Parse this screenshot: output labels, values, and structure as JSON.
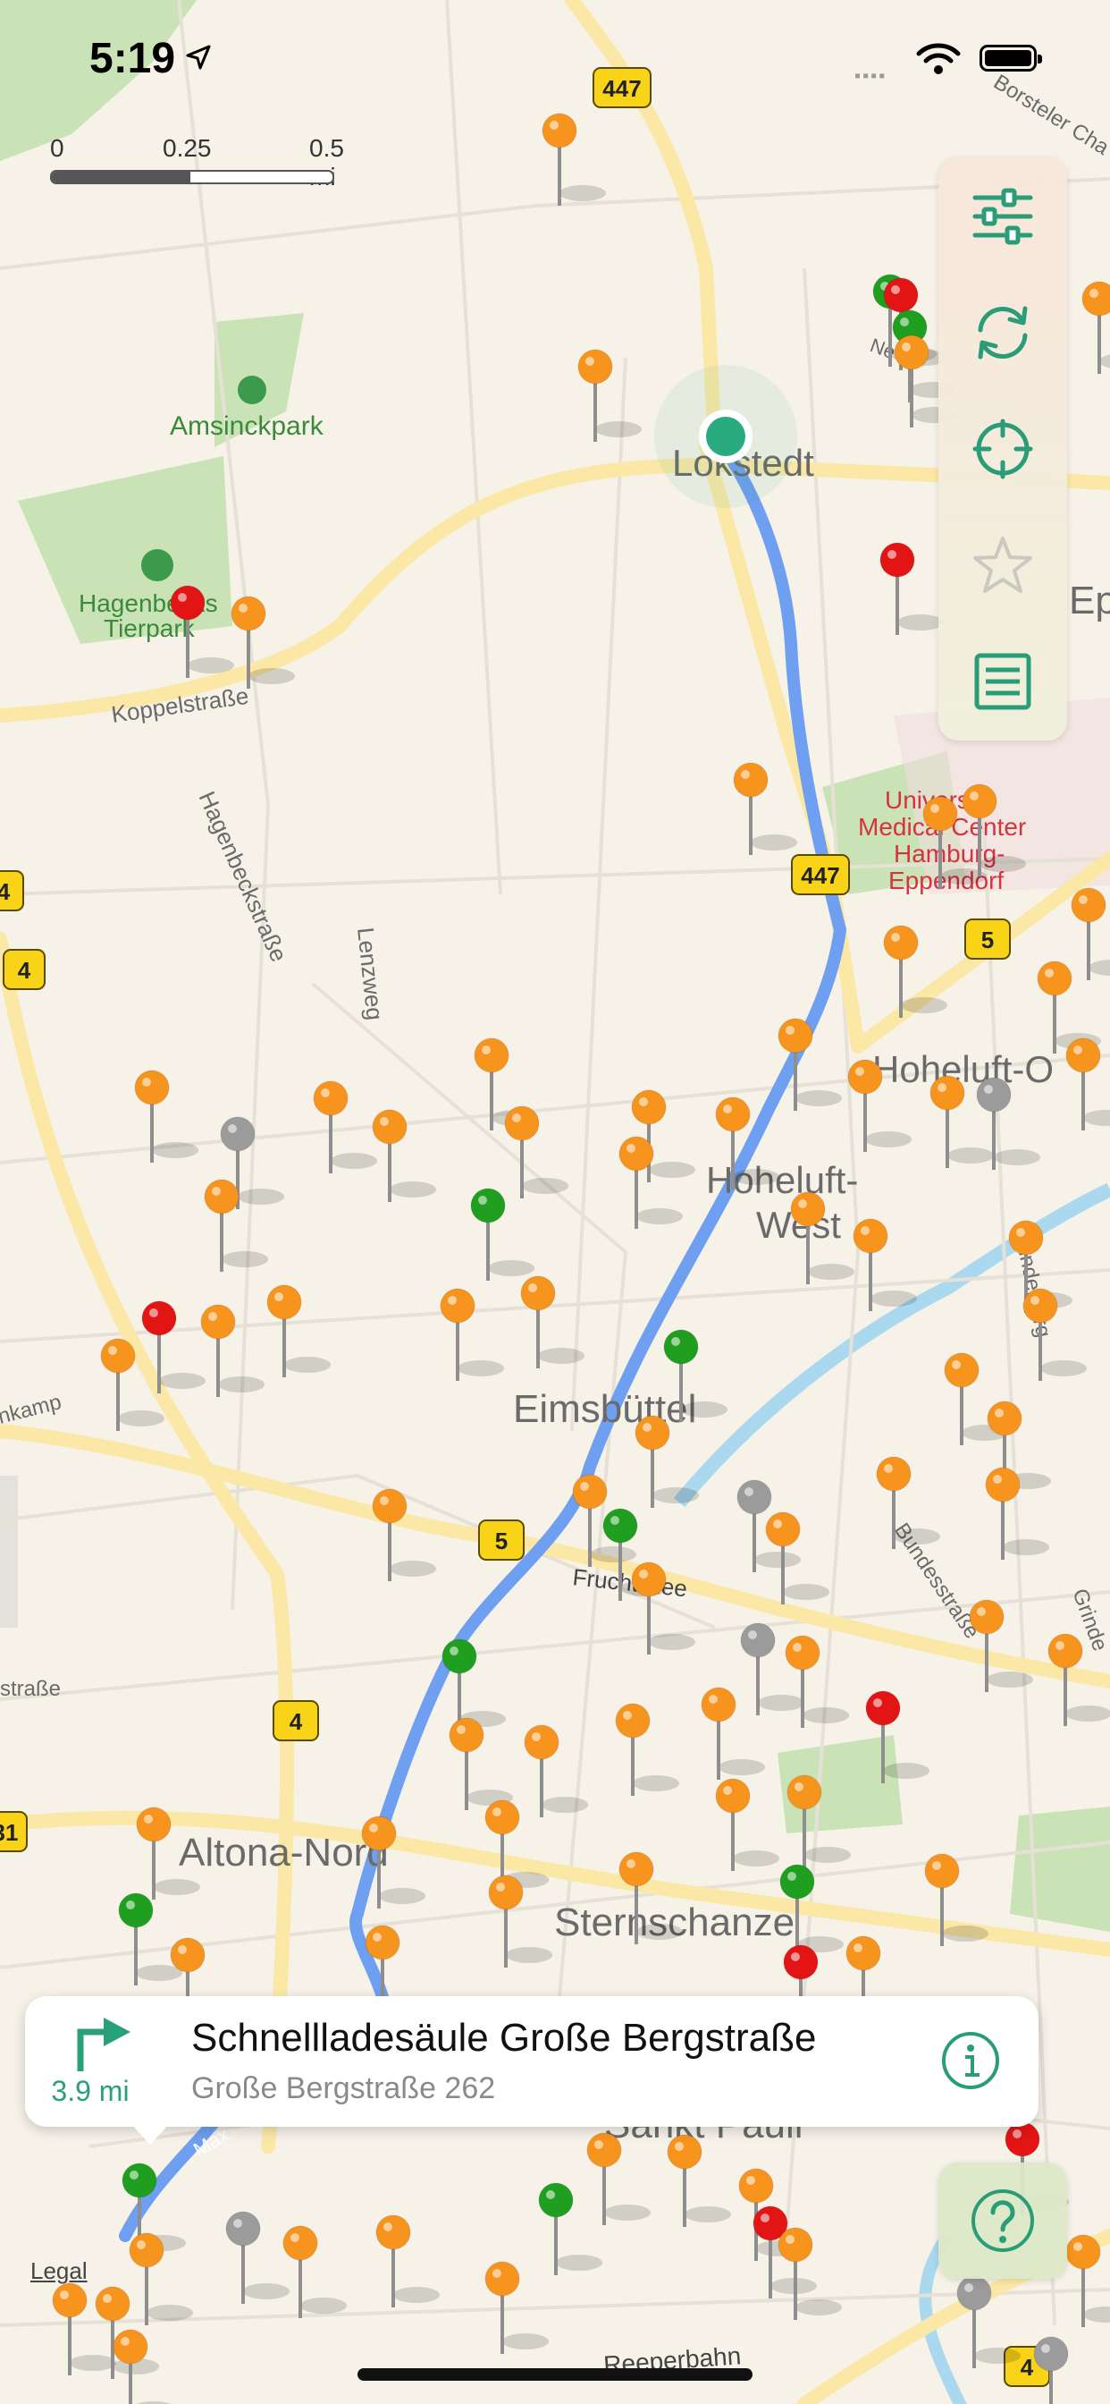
{
  "status_bar": {
    "time": "5:19",
    "icons": [
      "location-arrow-icon",
      "cellular-signal-icon",
      "wifi-icon",
      "battery-icon"
    ]
  },
  "scale": {
    "labels": [
      "0",
      "0.25",
      "0.5 mi"
    ]
  },
  "map": {
    "labels": {
      "lokstedt": "Lokstedt",
      "amsinckpark": "Amsinckpark",
      "hagenbecks": "Hagenbecks",
      "tierpark": "Tierpark",
      "koppelstrasse": "Koppelstraße",
      "hagenbeckstrasse": "Hagenbeckstraße",
      "lenzweg": "Lenzweg",
      "university_1": "University",
      "university_2": "Medical Center",
      "university_3": "Hamburg-",
      "university_4": "Eppendorf",
      "hoheluft_ost": "Hoheluft-O",
      "hoheluft_west_1": "Hoheluft-",
      "hoheluft_west_2": "West",
      "eimsbuettel": "Eimsbüttel",
      "fruchtallee": "Fruchtallee",
      "altona_nord": "Altona-Nord",
      "sternschanze": "Sternschanze",
      "sankt_pauli": "Sankt Pauli",
      "reeperbahn": "Reeperbahn",
      "bundesstrasse": "Bundesstraße",
      "isebek": "indelberg",
      "grindel": "Grinde",
      "borsteler": "Borsteler Cha",
      "ep": "Ep",
      "nkamp": "nkamp",
      "strasse_left": "straße",
      "maxstr": "Max",
      "ne": "Ne"
    },
    "road_shields": [
      "447",
      "447",
      "5",
      "5",
      "4",
      "4",
      "4",
      "31",
      "4"
    ],
    "colors": {
      "route": "#6f9ff0",
      "orange_pin": "#f7941d",
      "red_pin": "#e31414",
      "green_pin": "#1f9e1f",
      "gray_pin": "#9b9b9b",
      "current_location": "#2aaa7f"
    }
  },
  "toolbar": {
    "buttons": [
      "sliders-icon",
      "refresh-icon",
      "crosshair-icon",
      "star-icon",
      "list-icon"
    ]
  },
  "callout": {
    "distance": "3.9 mi",
    "title": "Schnellladesäule Große Bergstraße",
    "address": "Große Bergstraße 262"
  },
  "help": {
    "icon": "question-icon"
  },
  "legal": "Legal"
}
